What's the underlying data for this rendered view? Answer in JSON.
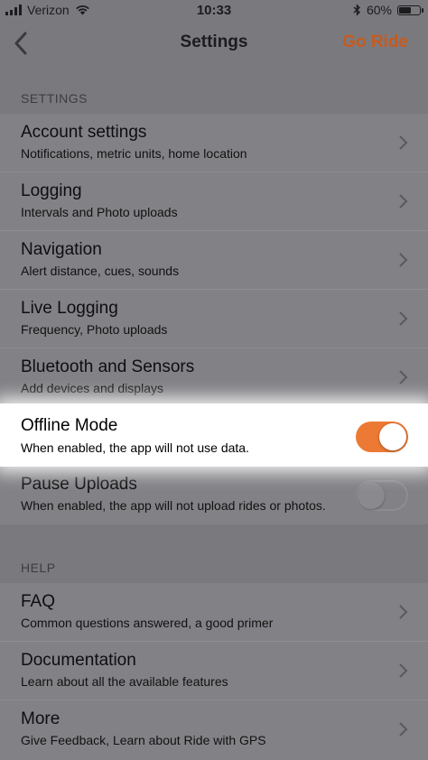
{
  "status_bar": {
    "carrier": "Verizon",
    "time": "10:33",
    "battery_percent": "60%",
    "battery_level": 0.6
  },
  "nav": {
    "title": "Settings",
    "action_label": "Go Ride"
  },
  "settings_section": {
    "header": "SETTINGS",
    "items": [
      {
        "label": "Account settings",
        "sub": "Notifications, metric units, home location"
      },
      {
        "label": "Logging",
        "sub": "Intervals and Photo uploads"
      },
      {
        "label": "Navigation",
        "sub": "Alert distance, cues, sounds"
      },
      {
        "label": "Live Logging",
        "sub": "Frequency, Photo uploads"
      },
      {
        "label": "Bluetooth and Sensors",
        "sub": "Add devices and displays"
      }
    ],
    "offline_mode": {
      "label": "Offline Mode",
      "sub": "When enabled, the app will not use data.",
      "enabled": true
    },
    "pause_uploads": {
      "label": "Pause Uploads",
      "sub": "When enabled, the app will not upload rides or photos.",
      "enabled": false
    }
  },
  "help_section": {
    "header": "HELP",
    "items": [
      {
        "label": "FAQ",
        "sub": "Common questions answered, a good primer"
      },
      {
        "label": "Documentation",
        "sub": "Learn about all the available features"
      },
      {
        "label": "More",
        "sub": "Give Feedback, Learn about Ride with GPS"
      }
    ]
  },
  "colors": {
    "accent": "#ec7a35",
    "action_text": "#c65a1f",
    "dim_background": "#7a7a7e",
    "highlight": "#ffffff"
  },
  "icons": {
    "back": "chevron-left-icon",
    "row": "chevron-right-icon",
    "signal": "cellular-signal-icon",
    "wifi": "wifi-icon",
    "bluetooth": "bluetooth-icon",
    "battery": "battery-icon"
  }
}
